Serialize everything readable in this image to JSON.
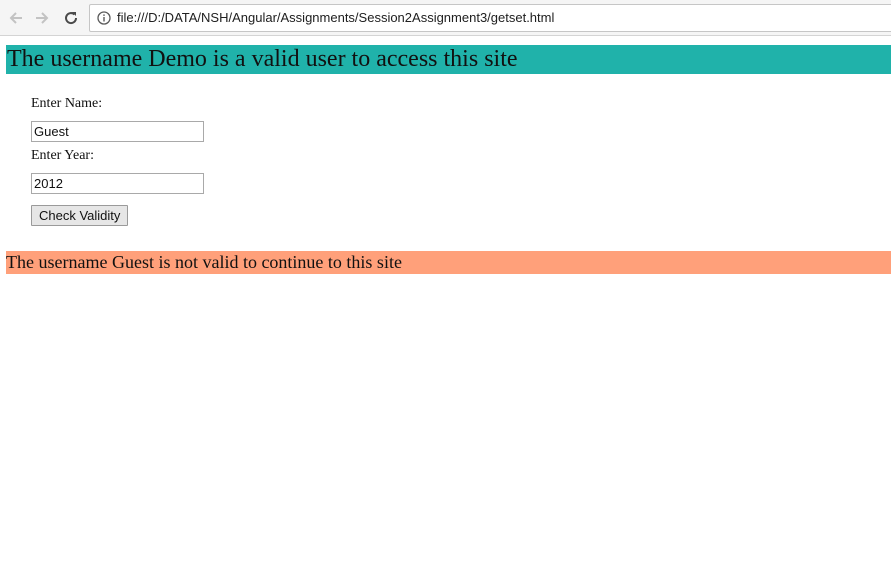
{
  "browser": {
    "url": "file:///D:/DATA/NSH/Angular/Assignments/Session2Assignment3/getset.html",
    "icons": {
      "back": "arrow-left",
      "forward": "arrow-right",
      "reload": "reload",
      "info": "info-circle"
    }
  },
  "page": {
    "valid_message": "The username Demo is a valid user to access this site",
    "name_label": "Enter Name:",
    "name_value": "Guest",
    "year_label": "Enter Year:",
    "year_value": "2012",
    "check_button_label": "Check Validity",
    "invalid_message": "The username Guest is not valid to continue to this site"
  },
  "colors": {
    "valid_banner_bg": "#20b2aa",
    "invalid_banner_bg": "#ffa07a"
  }
}
